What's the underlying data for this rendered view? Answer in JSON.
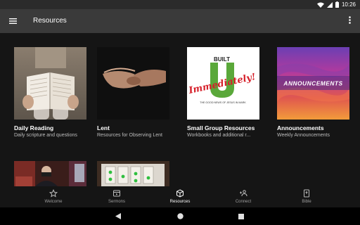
{
  "status": {
    "time": "10:26"
  },
  "app_bar": {
    "title": "Resources"
  },
  "cards": [
    {
      "title": "Daily Reading",
      "subtitle": "Daily scripture and questions"
    },
    {
      "title": "Lent",
      "subtitle": "Resources for Observing Lent"
    },
    {
      "title": "Small Group Resources",
      "subtitle": "Workbooks and additional r..."
    },
    {
      "title": "Announcements",
      "subtitle": "Weekly Announcements"
    }
  ],
  "small_group_logo": {
    "text_top": "BUILT",
    "text_script": "Immediately!",
    "text_bottom": "THE GOOD NEWS OF JESUS IN MARK"
  },
  "announcements_image_text": "ANNOUNCEMENTS",
  "bottom_nav": [
    {
      "label": "Welcome",
      "icon": "star-icon",
      "active": false
    },
    {
      "label": "Sermons",
      "icon": "sermons-icon",
      "active": false
    },
    {
      "label": "Resources",
      "icon": "box-icon",
      "active": true
    },
    {
      "label": "Connect",
      "icon": "connect-icon",
      "active": false
    },
    {
      "label": "Bible",
      "icon": "bible-icon",
      "active": false
    }
  ],
  "colors": {
    "app_bar": "#3a3a3a",
    "background": "#151515",
    "active_nav": "#ffffff",
    "inactive_nav": "#9e9e9e"
  }
}
